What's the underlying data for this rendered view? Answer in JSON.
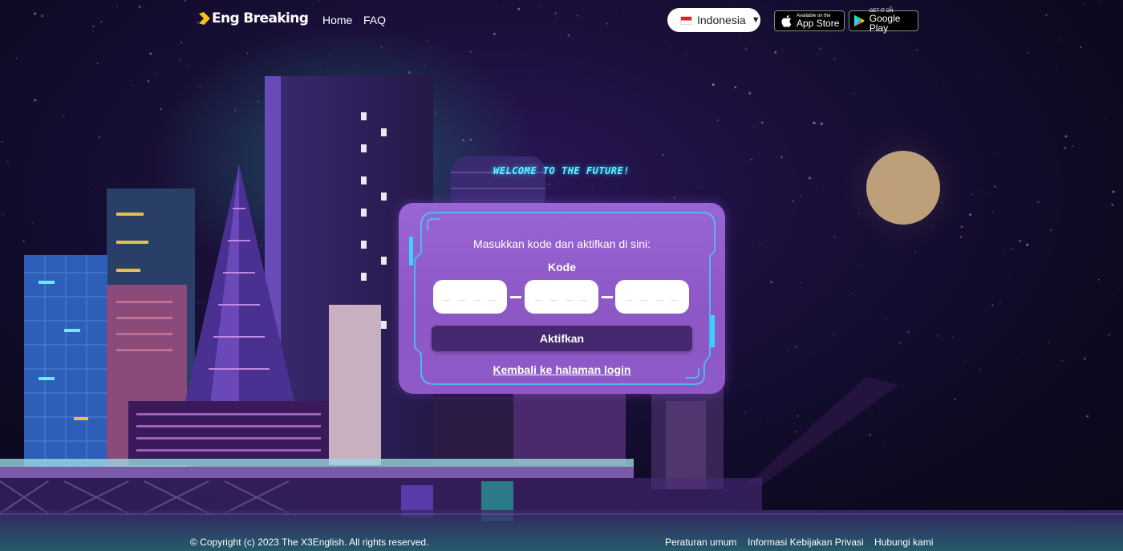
{
  "header": {
    "logo_text": "Eng Breaking",
    "nav": [
      {
        "label": "Home"
      },
      {
        "label": "FAQ"
      }
    ],
    "language": {
      "selected": "Indonesia"
    },
    "app_store": {
      "small": "Available on the",
      "big": "App Store"
    },
    "google_play": {
      "small": "GET IT ON",
      "big": "Google Play"
    }
  },
  "welcome_text": "WELCOME TO THE FUTURE!",
  "card": {
    "prompt": "Masukkan kode dan aktifkan di sini:",
    "code_label": "Kode",
    "code_placeholder": "_ _ _ _",
    "code_values": [
      "",
      "",
      ""
    ],
    "activate_button": "Aktifkan",
    "back_link": "Kembali ke halaman login"
  },
  "footer": {
    "copyright": "© Copyright (c) 2023 The X3English. All rights reserved.",
    "links": [
      "Peraturan umum",
      "Informasi Kebijakan Privasi",
      "Hubungi kami"
    ]
  },
  "colors": {
    "accent_cyan": "#5ff2ff",
    "card_purple": "#9a65d4",
    "button_dark": "#45286f"
  }
}
